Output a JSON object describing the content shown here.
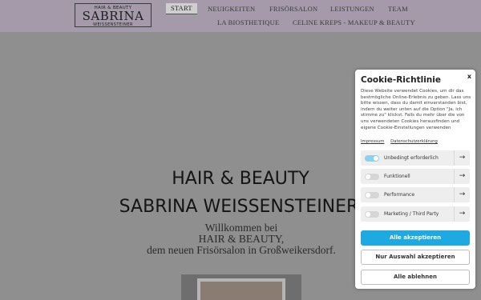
{
  "header": {
    "logo": {
      "top": "HAIR & BEAUTY",
      "main": "SABRINA",
      "sub": "WEISSENSTEINER"
    },
    "nav": [
      {
        "label": "START",
        "active": true
      },
      {
        "label": "NEUIGKEITEN"
      },
      {
        "label": "FRISÖRSALON"
      },
      {
        "label": "LEISTUNGEN"
      },
      {
        "label": "TEAM"
      },
      {
        "label": "LA BIOSTHETIQUE"
      },
      {
        "label": "CELINE KREPS - MAKEUP & BEAUTY"
      }
    ]
  },
  "main": {
    "heading1": "HAIR & BEAUTY",
    "heading2": "SABRINA WEISSENSTEINER",
    "welcome": [
      "Willkommen bei",
      "HAIR & BEAUTY,",
      "dem neuen Frisörsalon in Großweikersdorf."
    ]
  },
  "cookie": {
    "title": "Cookie-Richtlinie",
    "close": "x",
    "text": "Diese Website verwendet Cookies, um dir das bestmögliche Online-Erlebnis zu geben. Lass uns bitte wissen, dass du damit einverstanden bist, indem du weiter unten auf die Option \"Ja, ich stimme zu\" klickst. Falls du mehr über die von uns verwendeten Cookies herausfinden und eigene Cookie-Einstellungen verwenden",
    "links": [
      "Impressum",
      "Datenschutzerklärung"
    ],
    "categories": [
      {
        "label": "Unbedingt erforderlich",
        "enabled": true
      },
      {
        "label": "Funktionell",
        "enabled": false
      },
      {
        "label": "Performance",
        "enabled": false
      },
      {
        "label": "Marketing / Third Party",
        "enabled": false
      }
    ],
    "buttons": {
      "accept_all": "Alle akzeptieren",
      "accept_selection": "Nur Auswahl akzeptieren",
      "reject_all": "Alle ablehnen"
    }
  },
  "colors": {
    "accent": "#1ea9e1",
    "header_bg": "#a59aaa",
    "overlay_bg": "#8f8f8f"
  }
}
